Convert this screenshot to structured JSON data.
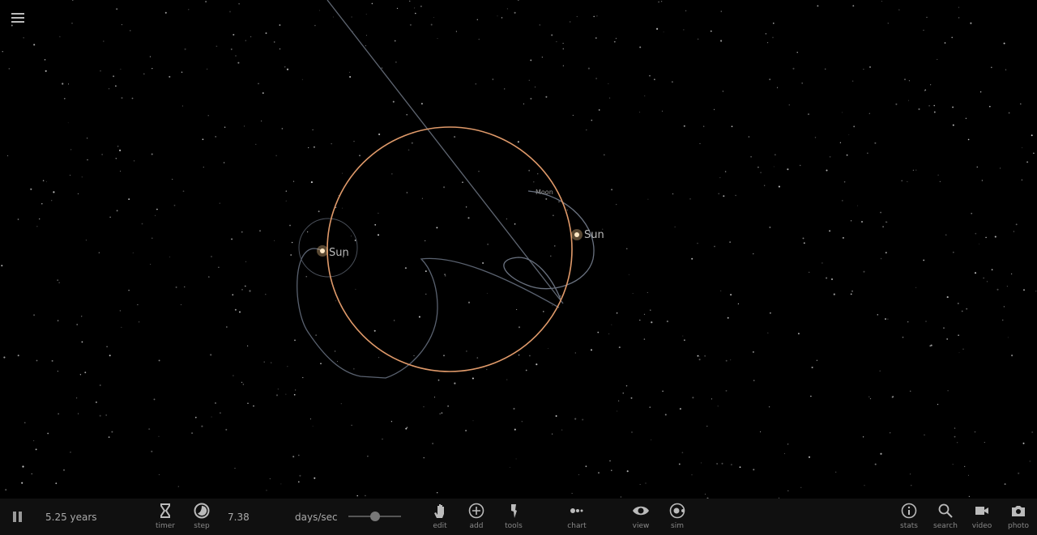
{
  "scene": {
    "bodies": [
      {
        "name": "Sun",
        "label": "Sun"
      },
      {
        "name": "Sun",
        "label": "Sun"
      },
      {
        "name": "Moon",
        "label": "Moon"
      }
    ],
    "colors": {
      "orbit_primary": "#e09a6a",
      "orbit_secondary": "#6c7480",
      "background": "#000000"
    }
  },
  "toolbar": {
    "time_elapsed": "5.25 years",
    "speed_value": "7.38",
    "speed_unit": "days/sec",
    "speed_slider_level": 0.5,
    "buttons": {
      "timer": "timer",
      "step": "step",
      "edit": "edit",
      "add": "add",
      "tools": "tools",
      "chart": "chart",
      "view": "view",
      "sim": "sim",
      "stats": "stats",
      "search": "search",
      "video": "video",
      "photo": "photo"
    }
  }
}
